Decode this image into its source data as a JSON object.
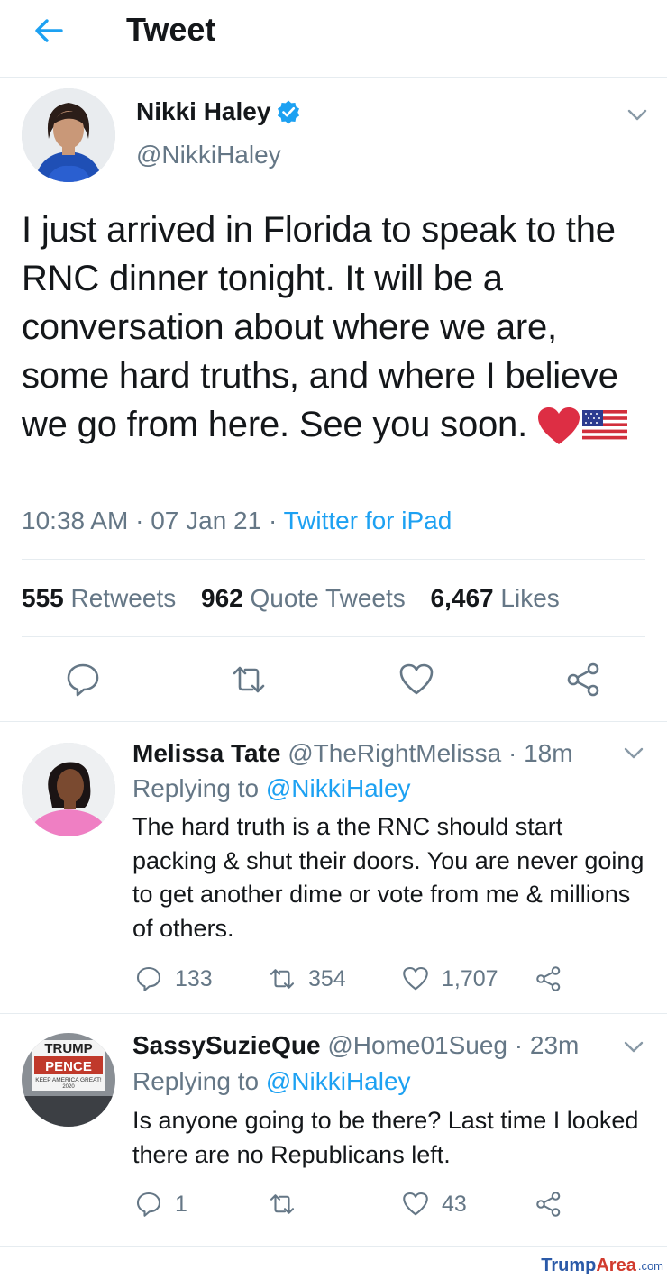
{
  "header": {
    "title": "Tweet",
    "back_icon": "arrow-left-icon",
    "accent": "#1da1f2"
  },
  "main_tweet": {
    "author": {
      "name": "Nikki Haley",
      "handle": "@NikkiHaley",
      "verified": true
    },
    "text": "I just arrived in Florida to speak to the RNC dinner tonight. It will be a conversation about where we are, some hard truths, and where I believe we go from here. See you soon.",
    "emojis": [
      "red-heart",
      "us-flag"
    ],
    "time": "10:38 AM",
    "date": "07 Jan 21",
    "source": "Twitter for iPad",
    "stats": {
      "retweets_count": "555",
      "retweets_label": "Retweets",
      "quotes_count": "962",
      "quotes_label": "Quote Tweets",
      "likes_count": "6,467",
      "likes_label": "Likes"
    },
    "actions": [
      "reply-icon",
      "retweet-icon",
      "like-icon",
      "share-icon"
    ]
  },
  "replies": [
    {
      "name": "Melissa Tate",
      "handle": "@TheRightMelissa",
      "time": "18m",
      "replying_label": "Replying to",
      "replying_to": "@NikkiHaley",
      "text": "The hard truth is a the RNC should start packing & shut their doors. You are never going to get another dime or vote from me & millions of others.",
      "reply_count": "133",
      "retweet_count": "354",
      "like_count": "1,707"
    },
    {
      "name": "SassySuzieQue",
      "handle": "@Home01Sueg",
      "time": "23m",
      "replying_label": "Replying to",
      "replying_to": "@NikkiHaley",
      "text": "Is anyone going to be there? Last time I looked there are no Republicans left.",
      "reply_count": "1",
      "retweet_count": "",
      "like_count": "43",
      "avatar_sign": {
        "line1": "TRUMP",
        "line2": "PENCE",
        "line3": "KEEP AMERICA GREAT!",
        "line4": "2020"
      }
    }
  ],
  "watermark": {
    "part1": "Trump",
    "part2": "Area",
    "part3": ".com"
  }
}
